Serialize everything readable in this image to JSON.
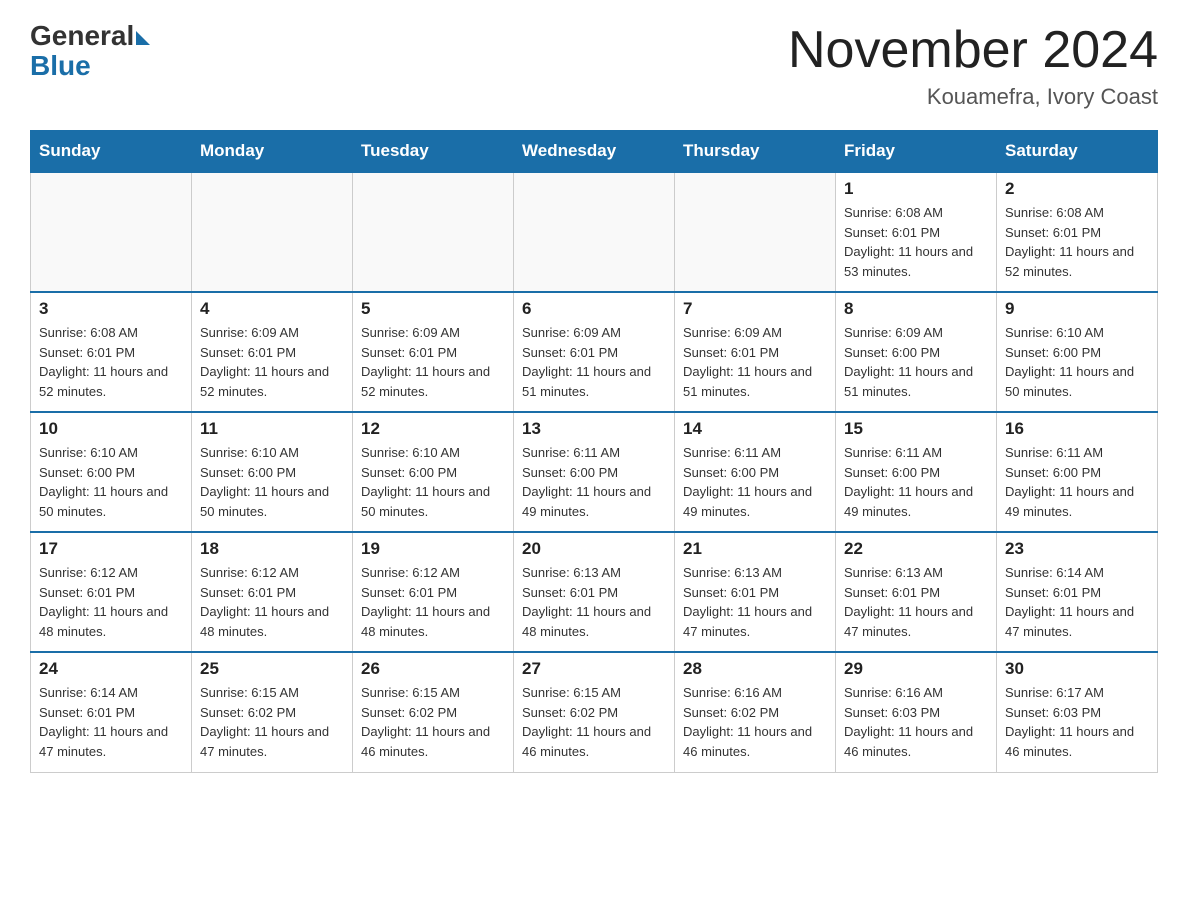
{
  "header": {
    "logo_general": "General",
    "logo_blue": "Blue",
    "month_title": "November 2024",
    "location": "Kouamefra, Ivory Coast"
  },
  "days_of_week": [
    "Sunday",
    "Monday",
    "Tuesday",
    "Wednesday",
    "Thursday",
    "Friday",
    "Saturday"
  ],
  "weeks": [
    [
      {
        "day": "",
        "sunrise": "",
        "sunset": "",
        "daylight": ""
      },
      {
        "day": "",
        "sunrise": "",
        "sunset": "",
        "daylight": ""
      },
      {
        "day": "",
        "sunrise": "",
        "sunset": "",
        "daylight": ""
      },
      {
        "day": "",
        "sunrise": "",
        "sunset": "",
        "daylight": ""
      },
      {
        "day": "",
        "sunrise": "",
        "sunset": "",
        "daylight": ""
      },
      {
        "day": "1",
        "sunrise": "Sunrise: 6:08 AM",
        "sunset": "Sunset: 6:01 PM",
        "daylight": "Daylight: 11 hours and 53 minutes."
      },
      {
        "day": "2",
        "sunrise": "Sunrise: 6:08 AM",
        "sunset": "Sunset: 6:01 PM",
        "daylight": "Daylight: 11 hours and 52 minutes."
      }
    ],
    [
      {
        "day": "3",
        "sunrise": "Sunrise: 6:08 AM",
        "sunset": "Sunset: 6:01 PM",
        "daylight": "Daylight: 11 hours and 52 minutes."
      },
      {
        "day": "4",
        "sunrise": "Sunrise: 6:09 AM",
        "sunset": "Sunset: 6:01 PM",
        "daylight": "Daylight: 11 hours and 52 minutes."
      },
      {
        "day": "5",
        "sunrise": "Sunrise: 6:09 AM",
        "sunset": "Sunset: 6:01 PM",
        "daylight": "Daylight: 11 hours and 52 minutes."
      },
      {
        "day": "6",
        "sunrise": "Sunrise: 6:09 AM",
        "sunset": "Sunset: 6:01 PM",
        "daylight": "Daylight: 11 hours and 51 minutes."
      },
      {
        "day": "7",
        "sunrise": "Sunrise: 6:09 AM",
        "sunset": "Sunset: 6:01 PM",
        "daylight": "Daylight: 11 hours and 51 minutes."
      },
      {
        "day": "8",
        "sunrise": "Sunrise: 6:09 AM",
        "sunset": "Sunset: 6:00 PM",
        "daylight": "Daylight: 11 hours and 51 minutes."
      },
      {
        "day": "9",
        "sunrise": "Sunrise: 6:10 AM",
        "sunset": "Sunset: 6:00 PM",
        "daylight": "Daylight: 11 hours and 50 minutes."
      }
    ],
    [
      {
        "day": "10",
        "sunrise": "Sunrise: 6:10 AM",
        "sunset": "Sunset: 6:00 PM",
        "daylight": "Daylight: 11 hours and 50 minutes."
      },
      {
        "day": "11",
        "sunrise": "Sunrise: 6:10 AM",
        "sunset": "Sunset: 6:00 PM",
        "daylight": "Daylight: 11 hours and 50 minutes."
      },
      {
        "day": "12",
        "sunrise": "Sunrise: 6:10 AM",
        "sunset": "Sunset: 6:00 PM",
        "daylight": "Daylight: 11 hours and 50 minutes."
      },
      {
        "day": "13",
        "sunrise": "Sunrise: 6:11 AM",
        "sunset": "Sunset: 6:00 PM",
        "daylight": "Daylight: 11 hours and 49 minutes."
      },
      {
        "day": "14",
        "sunrise": "Sunrise: 6:11 AM",
        "sunset": "Sunset: 6:00 PM",
        "daylight": "Daylight: 11 hours and 49 minutes."
      },
      {
        "day": "15",
        "sunrise": "Sunrise: 6:11 AM",
        "sunset": "Sunset: 6:00 PM",
        "daylight": "Daylight: 11 hours and 49 minutes."
      },
      {
        "day": "16",
        "sunrise": "Sunrise: 6:11 AM",
        "sunset": "Sunset: 6:00 PM",
        "daylight": "Daylight: 11 hours and 49 minutes."
      }
    ],
    [
      {
        "day": "17",
        "sunrise": "Sunrise: 6:12 AM",
        "sunset": "Sunset: 6:01 PM",
        "daylight": "Daylight: 11 hours and 48 minutes."
      },
      {
        "day": "18",
        "sunrise": "Sunrise: 6:12 AM",
        "sunset": "Sunset: 6:01 PM",
        "daylight": "Daylight: 11 hours and 48 minutes."
      },
      {
        "day": "19",
        "sunrise": "Sunrise: 6:12 AM",
        "sunset": "Sunset: 6:01 PM",
        "daylight": "Daylight: 11 hours and 48 minutes."
      },
      {
        "day": "20",
        "sunrise": "Sunrise: 6:13 AM",
        "sunset": "Sunset: 6:01 PM",
        "daylight": "Daylight: 11 hours and 48 minutes."
      },
      {
        "day": "21",
        "sunrise": "Sunrise: 6:13 AM",
        "sunset": "Sunset: 6:01 PM",
        "daylight": "Daylight: 11 hours and 47 minutes."
      },
      {
        "day": "22",
        "sunrise": "Sunrise: 6:13 AM",
        "sunset": "Sunset: 6:01 PM",
        "daylight": "Daylight: 11 hours and 47 minutes."
      },
      {
        "day": "23",
        "sunrise": "Sunrise: 6:14 AM",
        "sunset": "Sunset: 6:01 PM",
        "daylight": "Daylight: 11 hours and 47 minutes."
      }
    ],
    [
      {
        "day": "24",
        "sunrise": "Sunrise: 6:14 AM",
        "sunset": "Sunset: 6:01 PM",
        "daylight": "Daylight: 11 hours and 47 minutes."
      },
      {
        "day": "25",
        "sunrise": "Sunrise: 6:15 AM",
        "sunset": "Sunset: 6:02 PM",
        "daylight": "Daylight: 11 hours and 47 minutes."
      },
      {
        "day": "26",
        "sunrise": "Sunrise: 6:15 AM",
        "sunset": "Sunset: 6:02 PM",
        "daylight": "Daylight: 11 hours and 46 minutes."
      },
      {
        "day": "27",
        "sunrise": "Sunrise: 6:15 AM",
        "sunset": "Sunset: 6:02 PM",
        "daylight": "Daylight: 11 hours and 46 minutes."
      },
      {
        "day": "28",
        "sunrise": "Sunrise: 6:16 AM",
        "sunset": "Sunset: 6:02 PM",
        "daylight": "Daylight: 11 hours and 46 minutes."
      },
      {
        "day": "29",
        "sunrise": "Sunrise: 6:16 AM",
        "sunset": "Sunset: 6:03 PM",
        "daylight": "Daylight: 11 hours and 46 minutes."
      },
      {
        "day": "30",
        "sunrise": "Sunrise: 6:17 AM",
        "sunset": "Sunset: 6:03 PM",
        "daylight": "Daylight: 11 hours and 46 minutes."
      }
    ]
  ]
}
